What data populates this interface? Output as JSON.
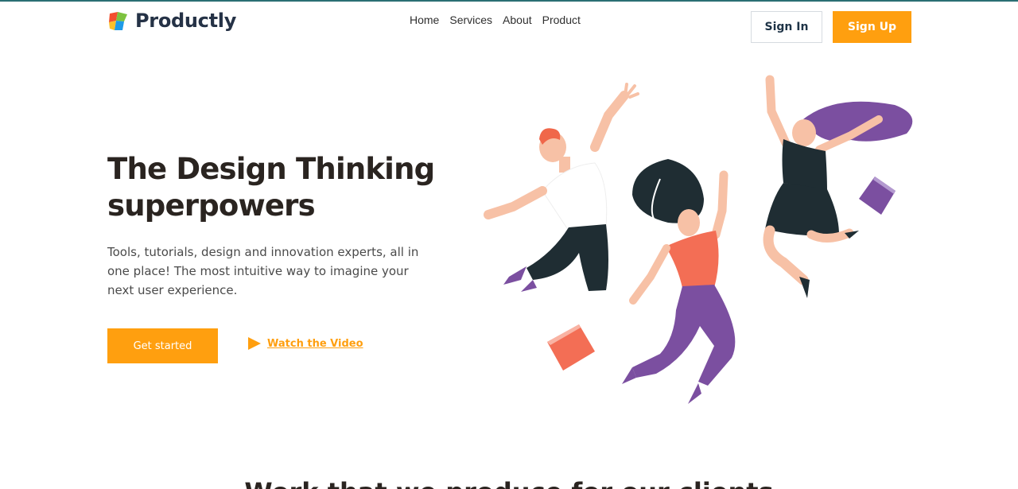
{
  "header": {
    "brand": "Productly",
    "nav": [
      "Home",
      "Services",
      "About",
      "Product"
    ],
    "sign_in": "Sign In",
    "sign_up": "Sign Up"
  },
  "hero": {
    "title_line1": "The Design Thinking",
    "title_line2": "superpowers",
    "subtitle": "Tools, tutorials, design and innovation experts, all in one place! The most intuitive way to imagine your next user experience.",
    "cta_primary": "Get started",
    "cta_secondary": "Watch the Video"
  },
  "next_section": {
    "title": "Work that we produce for our clients"
  },
  "icons": {
    "logo": "logo-icon",
    "play": "play-icon"
  },
  "colors": {
    "accent": "#ff9f0f",
    "heading": "#2a2420",
    "brand_text": "#253246"
  }
}
